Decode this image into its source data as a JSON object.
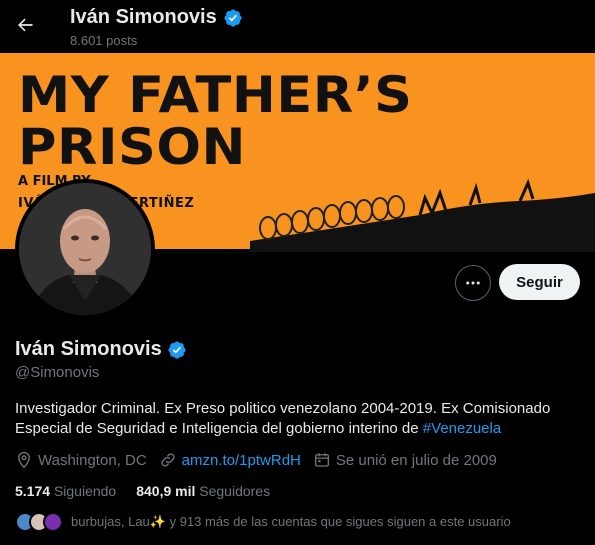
{
  "header": {
    "name": "Iván Simonovis",
    "posts": "8.601 posts"
  },
  "banner": {
    "title_line1": "MY FATHER’S",
    "title_line2": "PRISON",
    "credit_line1": "A FILM BY",
    "credit_line2": "IVÁ         XIS PERTIÑEZ"
  },
  "actions": {
    "follow_label": "Seguir"
  },
  "profile": {
    "name": "Iván Simonovis",
    "handle": "@Simonovis",
    "bio_text": "Investigador Criminal. Ex Preso politico venezolano 2004-2019. Ex Comisionado Especial de Seguridad e Inteligencia del gobierno interino de ",
    "bio_hashtag": "#Venezuela",
    "location": "Washington, DC",
    "website": "amzn.to/1ptwRdH",
    "joined": "Se unió en julio de 2009"
  },
  "stats": {
    "following_count": "5.174",
    "following_label": "Siguiendo",
    "followers_count": "840,9 mil",
    "followers_label": "Seguidores"
  },
  "followers_you_know": {
    "text": "burbujas, Lau✨ y 913 más de las cuentas que sigues siguen a este usuario"
  },
  "colors": {
    "background": "#000000",
    "banner": "#f7931e",
    "accent": "#1d9bf0",
    "verified": "#1d9bf0",
    "muted": "#71767b"
  },
  "icons": [
    "back-arrow-icon",
    "verified-badge-icon",
    "more-options-icon",
    "location-icon",
    "link-icon",
    "calendar-icon"
  ]
}
